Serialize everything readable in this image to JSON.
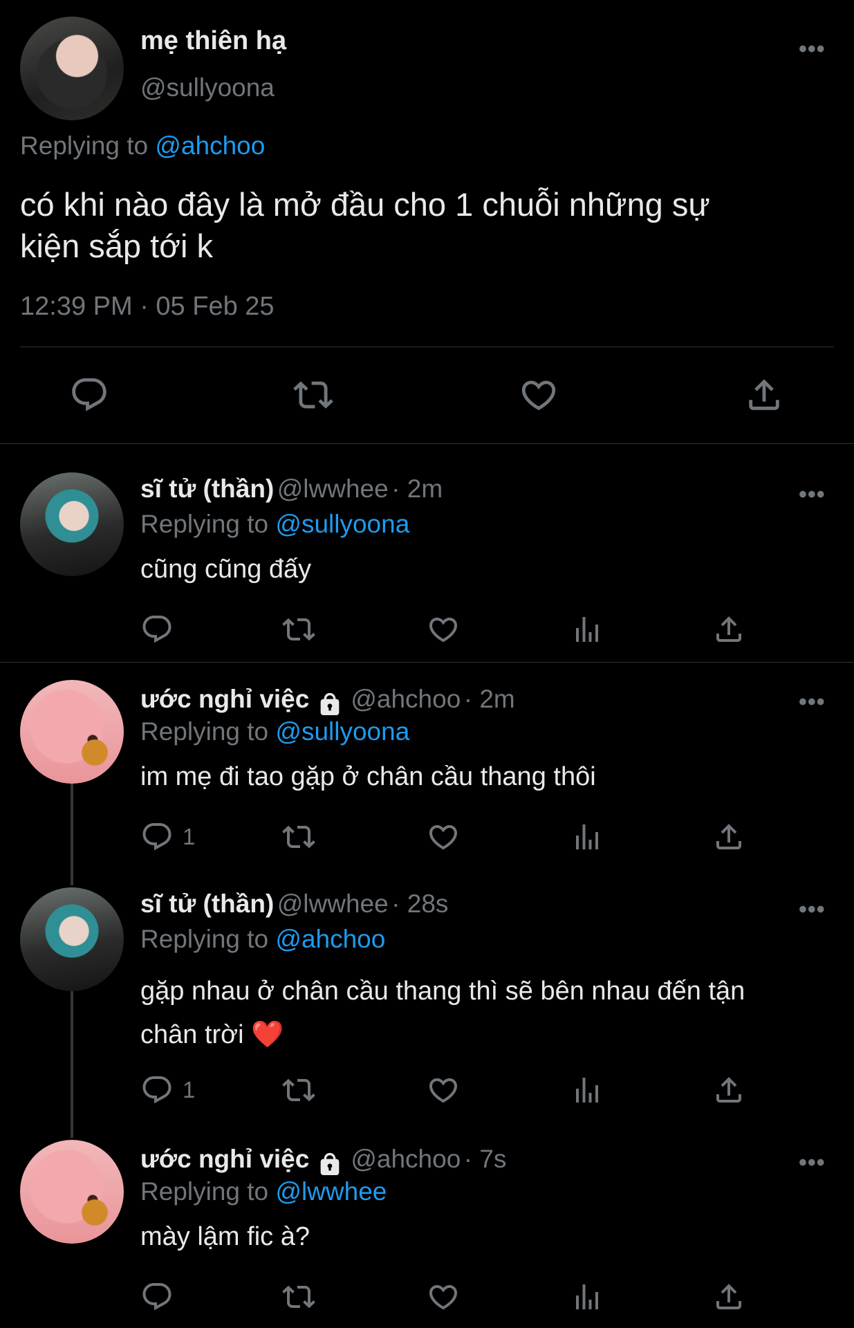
{
  "main_tweet": {
    "display_name": "mẹ thiên hạ",
    "handle": "@sullyoona",
    "replying_prefix": "Replying to",
    "replying_to": "@ahchoo",
    "text_line1": "có khi nào đây là mở đầu cho 1 chuỗi những sự",
    "text_line2": "kiện sắp tới k",
    "timestamp": "12:39 PM · 05 Feb 25"
  },
  "replies": [
    {
      "display_name": "sĩ tử (thần)",
      "handle": "@lwwhee",
      "time": "· 2m",
      "replying_prefix": "Replying to",
      "replying_to": "@sullyoona",
      "text": "cũng cũng đấy",
      "reply_count": ""
    },
    {
      "display_name": "ước nghỉ việc",
      "handle": "@ahchoo",
      "time": "· 2m",
      "replying_prefix": "Replying to",
      "replying_to": "@sullyoona",
      "text": "im mẹ đi tao gặp ở chân cầu thang thôi",
      "reply_count": "1"
    },
    {
      "display_name": "sĩ tử (thần)",
      "handle": "@lwwhee",
      "time": "· 28s",
      "replying_prefix": "Replying to",
      "replying_to": "@ahchoo",
      "text_line1": "gặp nhau ở chân cầu thang thì sẽ bên nhau đến tận",
      "text_line2": "chân trời ❤️",
      "reply_count": "1"
    },
    {
      "display_name": "ước nghỉ việc",
      "handle": "@ahchoo",
      "time": "· 7s",
      "replying_prefix": "Replying to",
      "replying_to": "@lwwhee",
      "text": "mày lậm fic à?",
      "reply_count": ""
    }
  ],
  "colors": {
    "background": "#000000",
    "link": "#1d9bf0",
    "secondary": "#71767b",
    "text": "#e7e9ea"
  },
  "icons": [
    "reply-icon",
    "retweet-icon",
    "like-icon",
    "views-icon",
    "share-icon",
    "more-icon",
    "lock-icon"
  ]
}
